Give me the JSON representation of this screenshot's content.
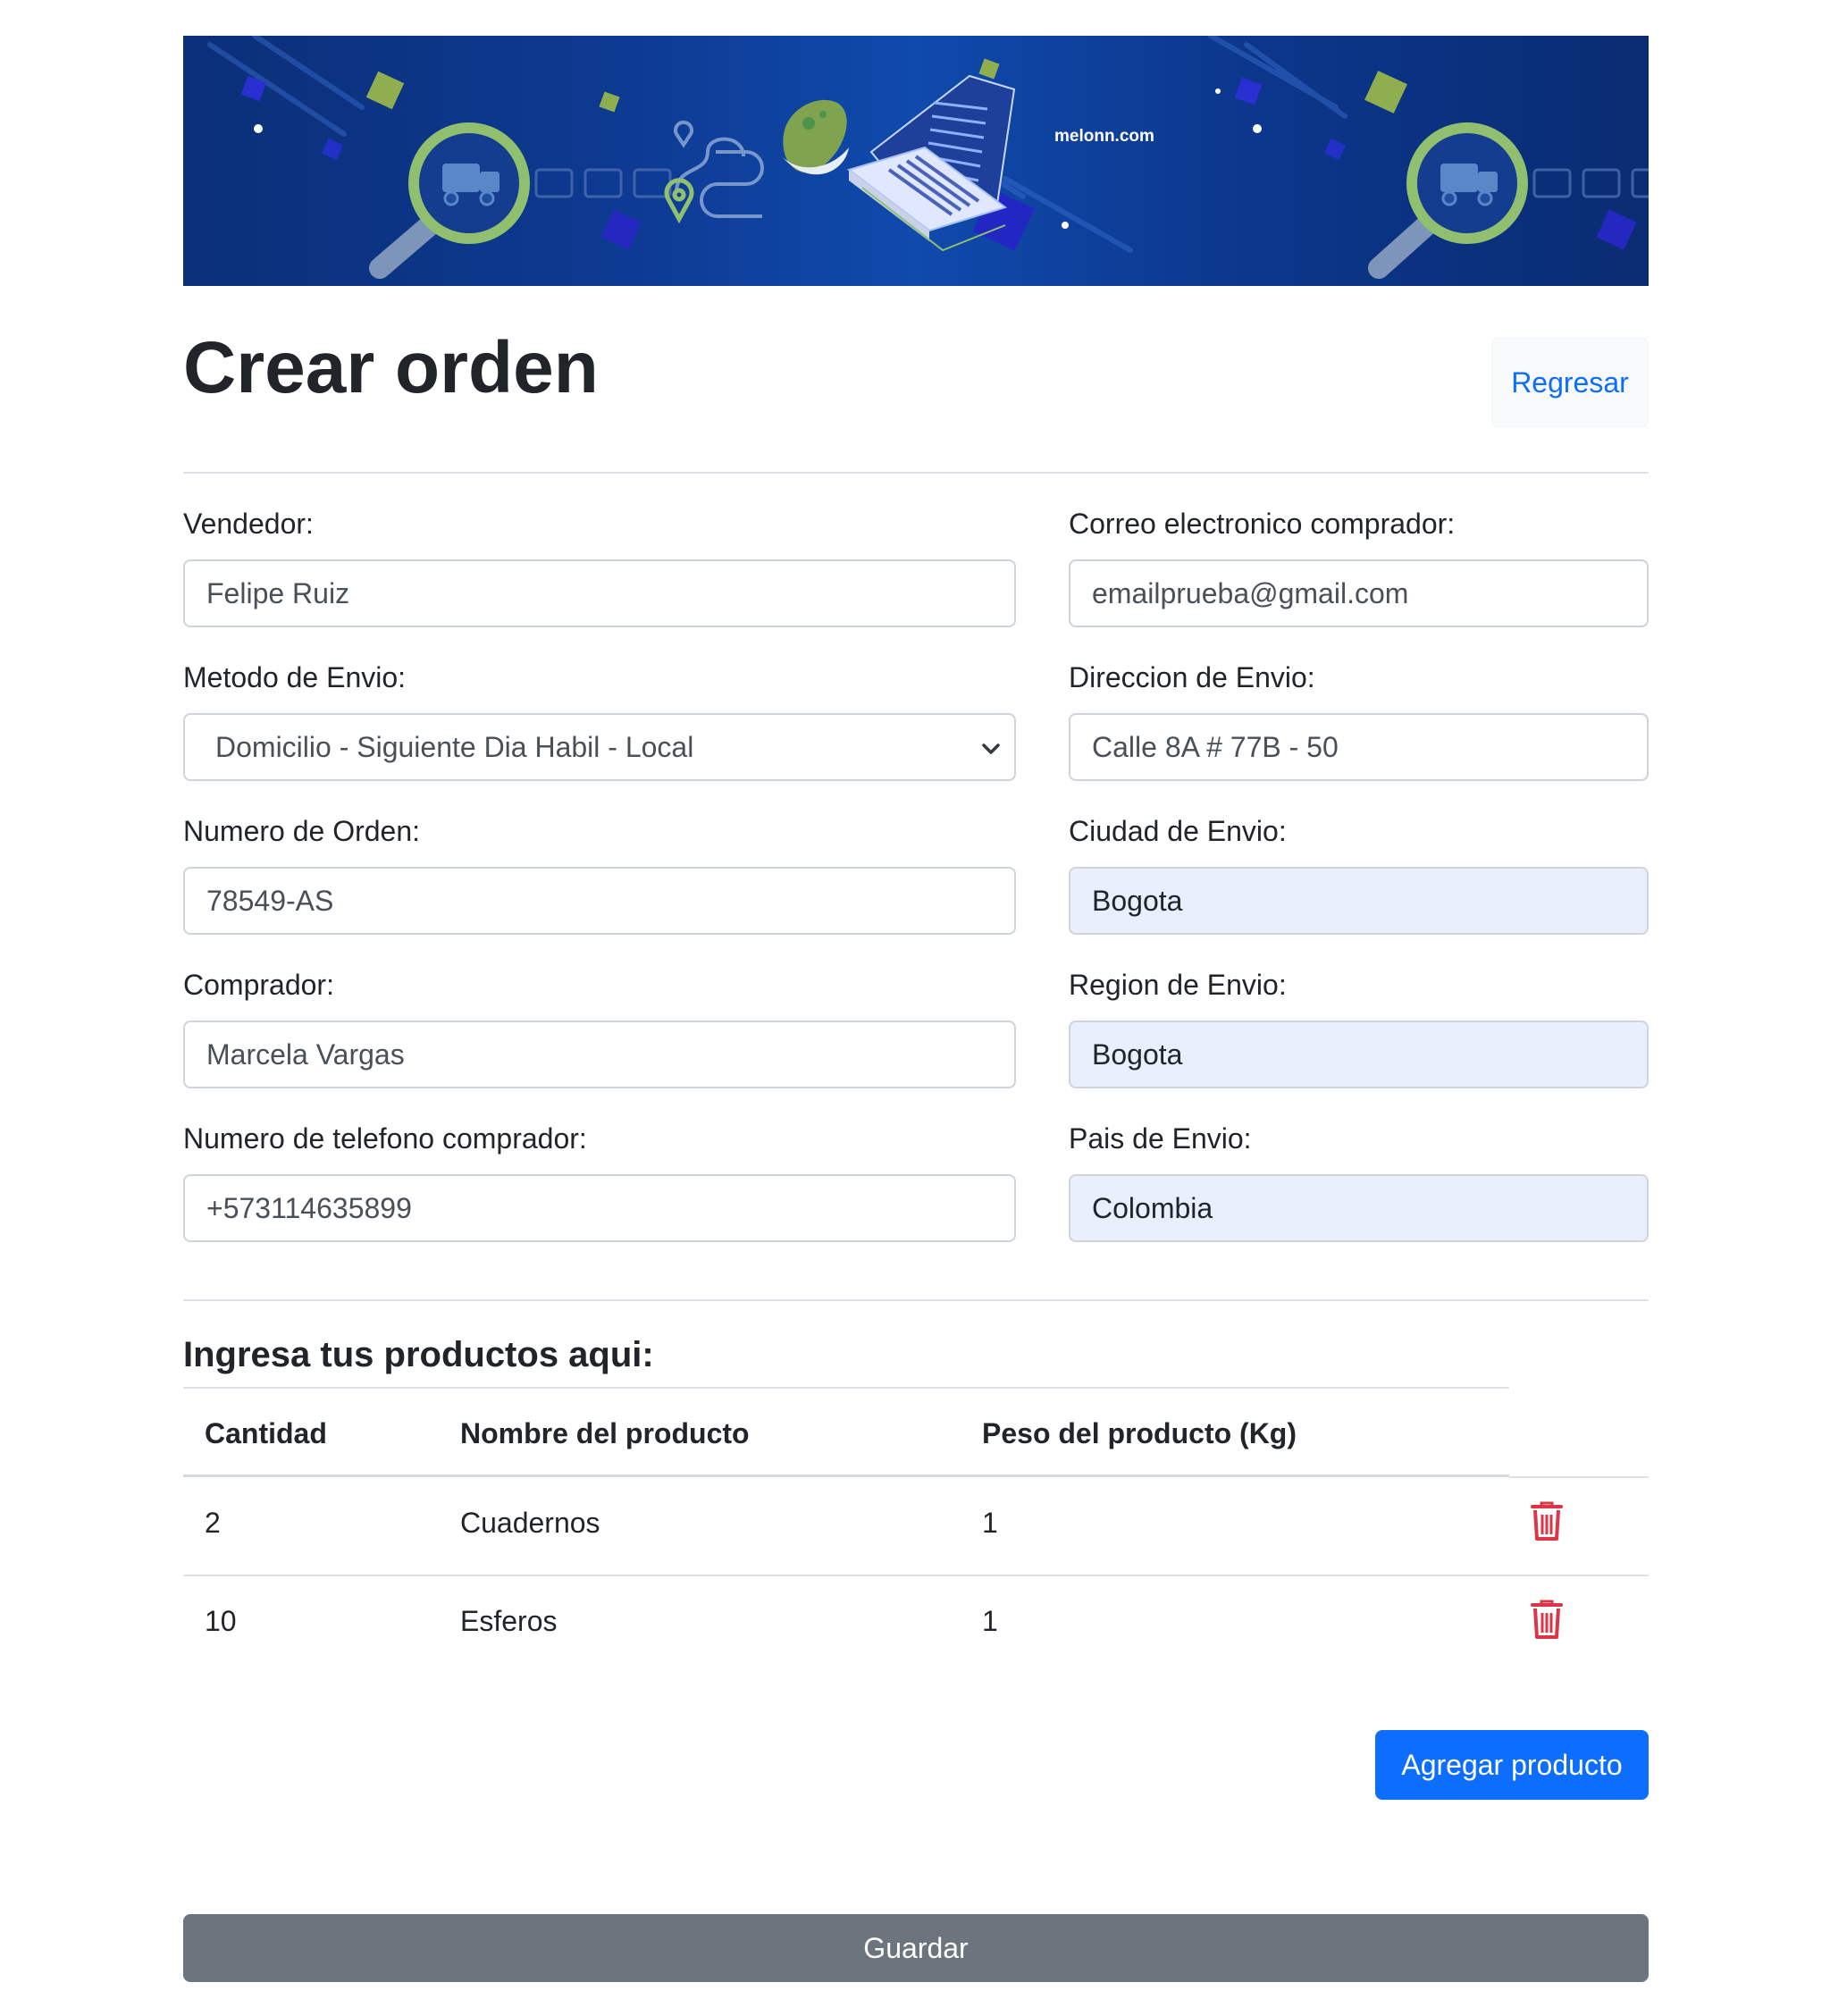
{
  "banner": {
    "brand_text": "melonn.com"
  },
  "header": {
    "title": "Crear orden",
    "back_label": "Regresar"
  },
  "form": {
    "vendedor": {
      "label": "Vendedor:",
      "value": "Felipe Ruiz"
    },
    "correo": {
      "label": "Correo electronico comprador:",
      "value": "emailprueba@gmail.com"
    },
    "metodo_envio": {
      "label": "Metodo de Envio:",
      "value": "Domicilio - Siguiente Dia Habil - Local"
    },
    "direccion": {
      "label": "Direccion de Envio:",
      "value": "Calle 8A # 77B - 50"
    },
    "numero_orden": {
      "label": "Numero de Orden:",
      "value": "78549-AS"
    },
    "ciudad": {
      "label": "Ciudad de Envio:",
      "value": "Bogota"
    },
    "comprador": {
      "label": "Comprador:",
      "value": "Marcela Vargas"
    },
    "region": {
      "label": "Region de Envio:",
      "value": "Bogota"
    },
    "telefono": {
      "label": "Numero de telefono comprador:",
      "value": "+573114635899"
    },
    "pais": {
      "label": "Pais de Envio:",
      "value": "Colombia"
    }
  },
  "products": {
    "title": "Ingresa tus productos aqui:",
    "columns": [
      "Cantidad",
      "Nombre del producto",
      "Peso del producto (Kg)"
    ],
    "rows": [
      {
        "cantidad": "2",
        "nombre": "Cuadernos",
        "peso": "1"
      },
      {
        "cantidad": "10",
        "nombre": "Esferos",
        "peso": "1"
      }
    ],
    "add_label": "Agregar producto"
  },
  "save_label": "Guardar",
  "colors": {
    "primary": "#0d6efd",
    "secondary": "#6c757d",
    "danger": "#dc3545",
    "autofill": "#e8f0fe"
  }
}
